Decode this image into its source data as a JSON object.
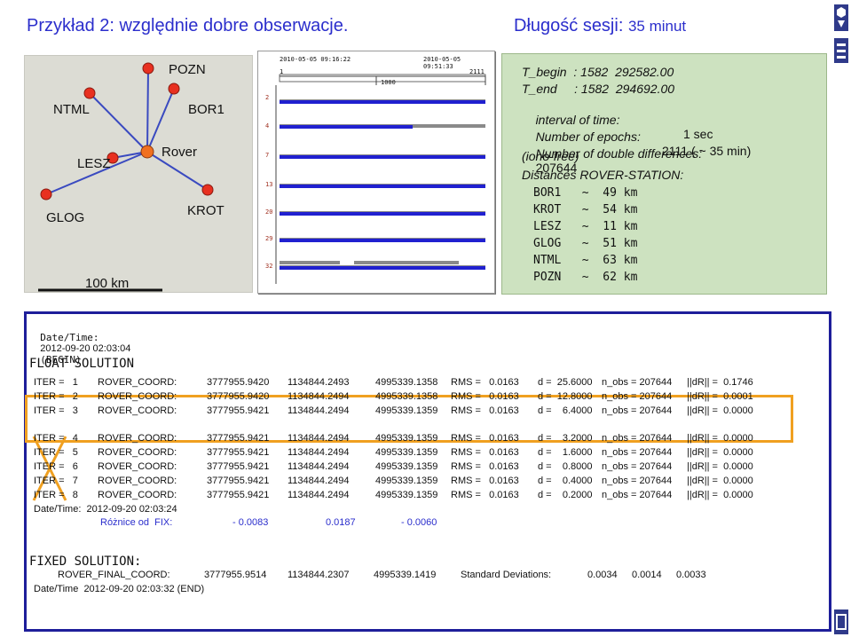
{
  "header": {
    "title": "Przykład 2:   względnie dobre  obserwacje.",
    "session_label": "Długość sesji:",
    "session_value": "35 minut"
  },
  "map": {
    "stations": [
      "POZN",
      "NTML",
      "BOR1",
      "LESZ",
      "Rover",
      "GLOG",
      "KROT"
    ],
    "scale": "100 km",
    "colors": {
      "station": "#e83020",
      "rover": "#f07020",
      "line": "#3a4ac0",
      "background": "#dcdcd4"
    }
  },
  "epochs": {
    "start_datetime": "2010-05-05 09:16:22",
    "end_datetime": "2010-05-05 09:51:33",
    "first_epoch": "1",
    "last_epoch": "2111",
    "tick": "1000",
    "satellites": [
      "2",
      "4",
      "7",
      "13",
      "20",
      "29",
      "32"
    ],
    "colors": {
      "bar": "#2020d0",
      "track": "#8a8a8a"
    }
  },
  "info": {
    "begin": "T_begin  : 1582  292582.00",
    "end": "T_end     : 1582  294692.00",
    "interval_label": "interval of time:",
    "interval_value": "1 sec",
    "epochs_label": "Number of epochs:",
    "epochs_value": "2111 ( ~ 35 min)",
    "dd_label": "Number of double differences:",
    "dd_value": "207644",
    "iono": "(iono-free)",
    "distances_label": "Distances ROVER-STATION:",
    "distances": [
      "BOR1   ~  49 km",
      "KROT   ~  54 km",
      "LESZ   ~  11 km",
      "GLOG   ~  51 km",
      "NTML   ~  63 km",
      "POZN   ~  62 km"
    ]
  },
  "log": {
    "begin_prefix": "Date/Time:",
    "begin_value": "2012-09-20 02:03:04",
    "begin_suffix": "(BEGIN)",
    "float_title": "FLOAT SOLUTION",
    "iterations": [
      {
        "iter": "ITER =   1",
        "label": "ROVER_COORD:",
        "x": "3777955.9420",
        "y": "1134844.2493",
        "z": "4995339.1358",
        "rms": "RMS =   0.0163",
        "d": "d =  25.6000",
        "nobs": "n_obs = 207644",
        "dr": "||dR|| =  0.1746"
      },
      {
        "iter": "ITER =   2",
        "label": "ROVER_COORD:",
        "x": "3777955.9420",
        "y": "1134844.2494",
        "z": "4995339.1358",
        "rms": "RMS =   0.0163",
        "d": "d =  12.8000",
        "nobs": "n_obs = 207644",
        "dr": "||dR|| =  0.0001"
      },
      {
        "iter": "ITER =   3",
        "label": "ROVER_COORD:",
        "x": "3777955.9421",
        "y": "1134844.2494",
        "z": "4995339.1359",
        "rms": "RMS =   0.0163",
        "d": "d =    6.4000",
        "nobs": "n_obs = 207644",
        "dr": "||dR|| =  0.0000"
      },
      {
        "iter": "ITER =   4",
        "label": "ROVER_COORD:",
        "x": "3777955.9421",
        "y": "1134844.2494",
        "z": "4995339.1359",
        "rms": "RMS =   0.0163",
        "d": "d =    3.2000",
        "nobs": "n_obs = 207644",
        "dr": "||dR|| =  0.0000"
      },
      {
        "iter": "ITER =   5",
        "label": "ROVER_COORD:",
        "x": "3777955.9421",
        "y": "1134844.2494",
        "z": "4995339.1359",
        "rms": "RMS =   0.0163",
        "d": "d =    1.6000",
        "nobs": "n_obs = 207644",
        "dr": "||dR|| =  0.0000"
      },
      {
        "iter": "ITER =   6",
        "label": "ROVER_COORD:",
        "x": "3777955.9421",
        "y": "1134844.2494",
        "z": "4995339.1359",
        "rms": "RMS =   0.0163",
        "d": "d =    0.8000",
        "nobs": "n_obs = 207644",
        "dr": "||dR|| =  0.0000"
      },
      {
        "iter": "ITER =   7",
        "label": "ROVER_COORD:",
        "x": "3777955.9421",
        "y": "1134844.2494",
        "z": "4995339.1359",
        "rms": "RMS =   0.0163",
        "d": "d =    0.4000",
        "nobs": "n_obs = 207644",
        "dr": "||dR|| =  0.0000"
      },
      {
        "iter": "ITER =   8",
        "label": "ROVER_COORD:",
        "x": "3777955.9421",
        "y": "1134844.2494",
        "z": "4995339.1359",
        "rms": "RMS =   0.0163",
        "d": "d =    0.2000",
        "nobs": "n_obs = 207644",
        "dr": "||dR|| =  0.0000"
      }
    ],
    "float_end": "Date/Time:  2012-09-20 02:03:24",
    "diff_label": "Różnice od  FIX:",
    "diff_values": [
      "- 0.0083",
      "0.0187",
      "- 0.0060"
    ],
    "fixed_title": "FIXED SOLUTION:",
    "final_label": "ROVER_FINAL_COORD:",
    "final_x": "3777955.9514",
    "final_y": "1134844.2307",
    "final_z": "4995339.1419",
    "std_label": "Standard Deviations:",
    "std_values": [
      "0.0034",
      "0.0014",
      "0.0033"
    ],
    "end_line": "Date/Time  2012-09-20 02:03:32 (END)",
    "highlight_color": "#f0a020"
  }
}
